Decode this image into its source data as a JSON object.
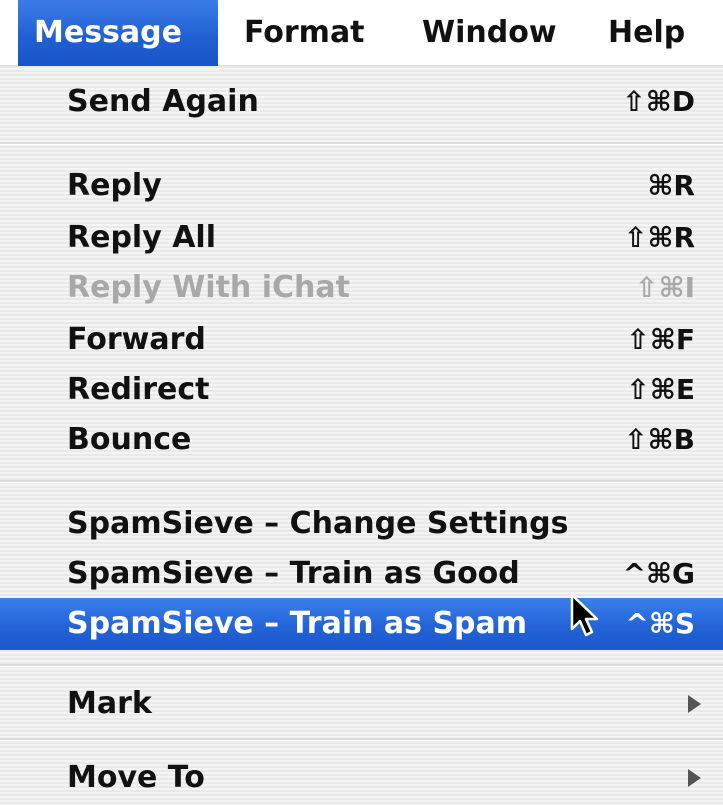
{
  "menubar": {
    "items": [
      {
        "label": "Message",
        "active": true
      },
      {
        "label": "Format",
        "active": false
      },
      {
        "label": "Window",
        "active": false
      },
      {
        "label": "Help",
        "active": false
      }
    ]
  },
  "menu": {
    "title": "Message",
    "items": [
      {
        "label": "Send Again",
        "shortcut": "⇧⌘D",
        "enabled": true
      },
      {
        "label": "Reply",
        "shortcut": "⌘R",
        "enabled": true
      },
      {
        "label": "Reply All",
        "shortcut": "⇧⌘R",
        "enabled": true
      },
      {
        "label": "Reply With iChat",
        "shortcut": "⇧⌘I",
        "enabled": false
      },
      {
        "label": "Forward",
        "shortcut": "⇧⌘F",
        "enabled": true
      },
      {
        "label": "Redirect",
        "shortcut": "⇧⌘E",
        "enabled": true
      },
      {
        "label": "Bounce",
        "shortcut": "⇧⌘B",
        "enabled": true
      },
      {
        "label": "SpamSieve – Change Settings",
        "shortcut": "",
        "enabled": true
      },
      {
        "label": "SpamSieve – Train as Good",
        "shortcut": "^⌘G",
        "enabled": true
      },
      {
        "label": "SpamSieve – Train as Spam",
        "shortcut": "^⌘S",
        "enabled": true,
        "highlighted": true
      },
      {
        "label": "Mark",
        "shortcut": "",
        "enabled": true,
        "submenu": true
      },
      {
        "label": "Move To",
        "shortcut": "",
        "enabled": true,
        "submenu": true
      }
    ]
  },
  "icons": {
    "submenu_arrow": "triangle-right-icon",
    "cursor": "mouse-pointer-icon"
  },
  "colors": {
    "highlight": "#2363d8",
    "text": "#111111",
    "disabled_text": "#a8a8a8"
  }
}
